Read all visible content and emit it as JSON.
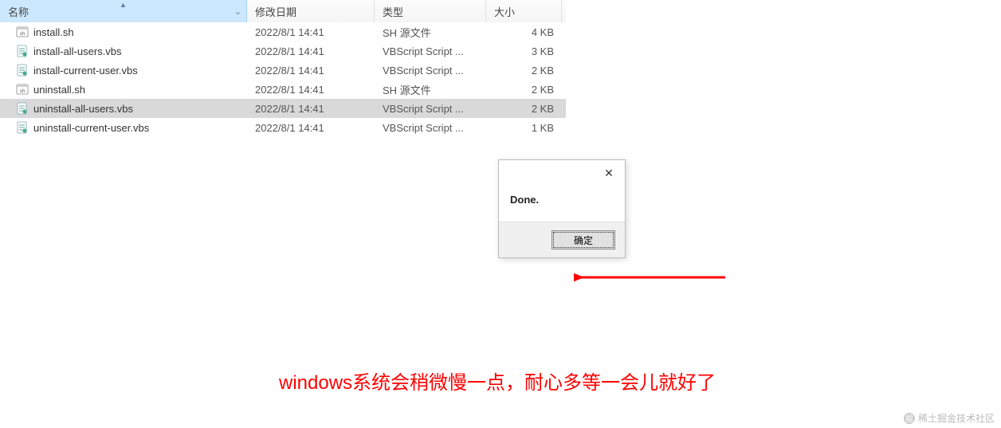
{
  "columns": {
    "name": "名称",
    "date": "修改日期",
    "type": "类型",
    "size": "大小"
  },
  "files": [
    {
      "name": "install.sh",
      "date": "2022/8/1 14:41",
      "type": "SH 源文件",
      "size": "4 KB",
      "icon": "sh",
      "selected": false
    },
    {
      "name": "install-all-users.vbs",
      "date": "2022/8/1 14:41",
      "type": "VBScript Script ...",
      "size": "3 KB",
      "icon": "vbs",
      "selected": false
    },
    {
      "name": "install-current-user.vbs",
      "date": "2022/8/1 14:41",
      "type": "VBScript Script ...",
      "size": "2 KB",
      "icon": "vbs",
      "selected": false
    },
    {
      "name": "uninstall.sh",
      "date": "2022/8/1 14:41",
      "type": "SH 源文件",
      "size": "2 KB",
      "icon": "sh",
      "selected": false
    },
    {
      "name": "uninstall-all-users.vbs",
      "date": "2022/8/1 14:41",
      "type": "VBScript Script ...",
      "size": "2 KB",
      "icon": "vbs",
      "selected": true
    },
    {
      "name": "uninstall-current-user.vbs",
      "date": "2022/8/1 14:41",
      "type": "VBScript Script ...",
      "size": "1 KB",
      "icon": "vbs",
      "selected": false
    }
  ],
  "dialog": {
    "message": "Done.",
    "ok_label": "确定"
  },
  "caption": "windows系统会稍微慢一点，耐心多等一会儿就好了",
  "watermark": "稀土掘金技术社区"
}
